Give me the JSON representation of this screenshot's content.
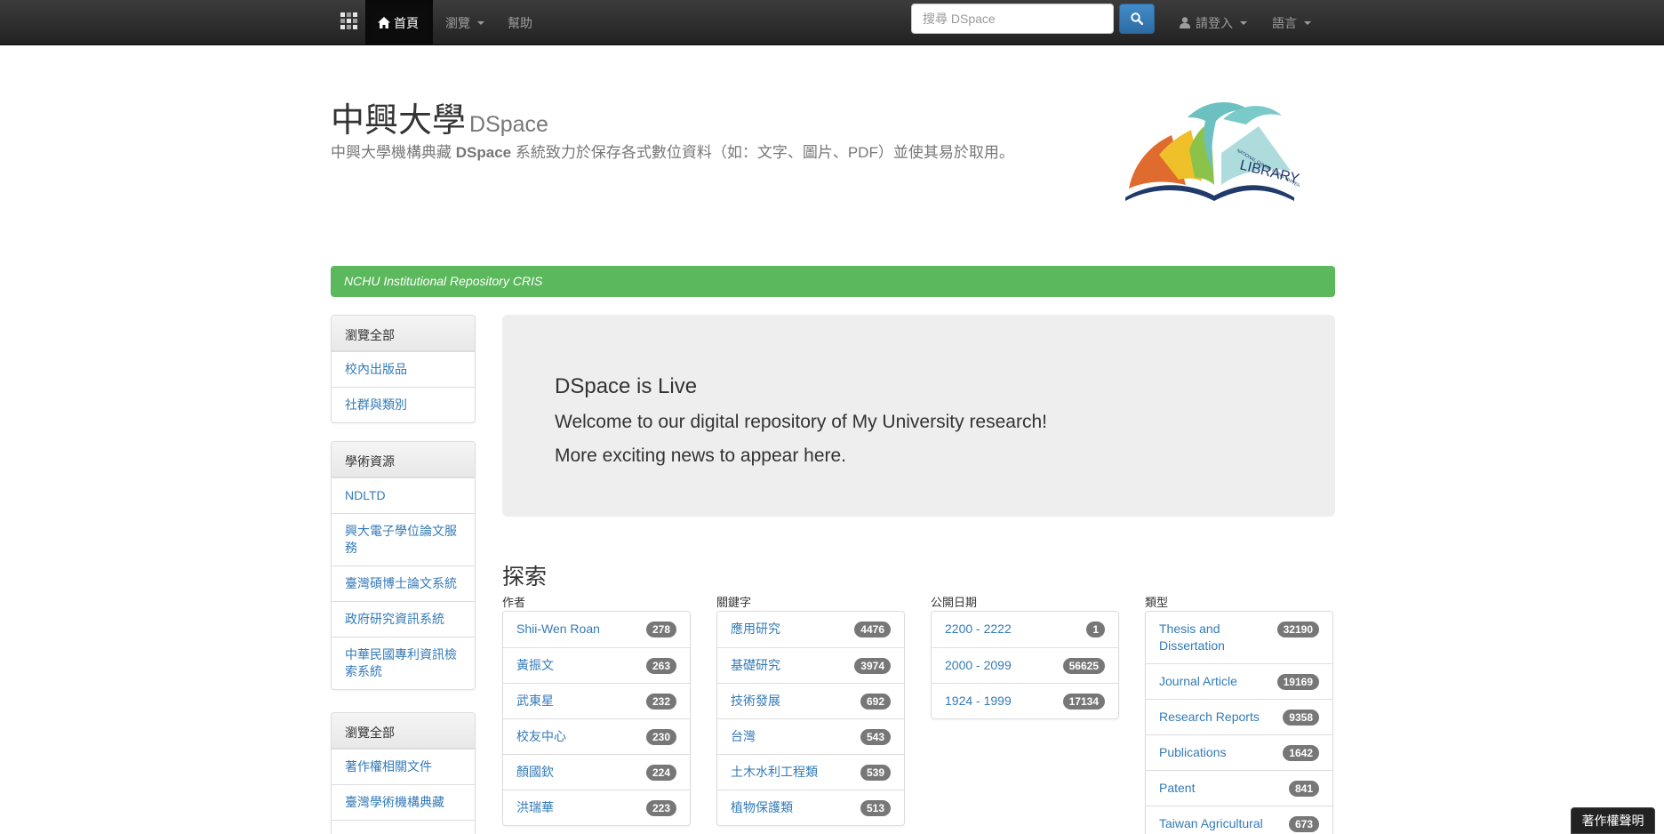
{
  "navbar": {
    "home": "首頁",
    "browse": "瀏覽",
    "help": "幫助",
    "search_placeholder": "搜尋 DSpace",
    "login": "請登入",
    "language": "語言"
  },
  "header": {
    "title": "中興大學",
    "title_suffix": "DSpace",
    "desc_prefix": "中興大學機構典藏 ",
    "desc_bold": "DSpace",
    "desc_suffix": " 系統致力於保存各式數位資料（如：文字、圖片、PDF）並使其易於取用。",
    "logo_text_small": "NATIONAL CHUNG HSING UNIVERSITY",
    "logo_text": "LIBRARY"
  },
  "banner": "NCHU Institutional Repository CRIS",
  "sidebar": [
    {
      "heading": "瀏覽全部",
      "items": [
        "校內出版品",
        "社群與類別"
      ]
    },
    {
      "heading": "學術資源",
      "items": [
        "NDLTD",
        "興大電子學位論文服務",
        "臺灣碩博士論文系統",
        "政府研究資訊系統",
        "中華民國專利資訊檢索系統"
      ]
    },
    {
      "heading": "瀏覽全部",
      "items": [
        "著作權相關文件",
        "臺灣學術機構典藏"
      ]
    }
  ],
  "jumbotron": {
    "title": "DSpace is Live",
    "line1": "Welcome to our digital repository of My University research!",
    "line2": "More exciting news to appear here."
  },
  "explore": {
    "title": "探索",
    "facets": [
      {
        "label": "作者",
        "items": [
          {
            "name": "Shii-Wen Roan",
            "count": "278"
          },
          {
            "name": "黃振文",
            "count": "263"
          },
          {
            "name": "武東星",
            "count": "232"
          },
          {
            "name": "校友中心",
            "count": "230"
          },
          {
            "name": "顏國欽",
            "count": "224"
          },
          {
            "name": "洪瑞華",
            "count": "223"
          }
        ]
      },
      {
        "label": "關鍵字",
        "items": [
          {
            "name": "應用研究",
            "count": "4476"
          },
          {
            "name": "基礎研究",
            "count": "3974"
          },
          {
            "name": "技術發展",
            "count": "692"
          },
          {
            "name": "台灣",
            "count": "543"
          },
          {
            "name": "土木水利工程類",
            "count": "539"
          },
          {
            "name": "植物保護類",
            "count": "513"
          }
        ]
      },
      {
        "label": "公開日期",
        "items": [
          {
            "name": "2200 - 2222",
            "count": "1"
          },
          {
            "name": "2000 - 2099",
            "count": "56625"
          },
          {
            "name": "1924 - 1999",
            "count": "17134"
          }
        ]
      },
      {
        "label": "類型",
        "items": [
          {
            "name": "Thesis and Dissertation",
            "count": "32190"
          },
          {
            "name": "Journal Article",
            "count": "19169"
          },
          {
            "name": "Research Reports",
            "count": "9358"
          },
          {
            "name": "Publications",
            "count": "1642"
          },
          {
            "name": "Patent",
            "count": "841"
          },
          {
            "name": "Taiwan Agricultural",
            "count": "673"
          }
        ]
      }
    ]
  },
  "copyright": "著作權聲明",
  "colors": {
    "navbar": "#222222",
    "banner": "#5cb85c",
    "link": "#337ab7",
    "badge": "#777777",
    "search_button": "#428bca"
  }
}
